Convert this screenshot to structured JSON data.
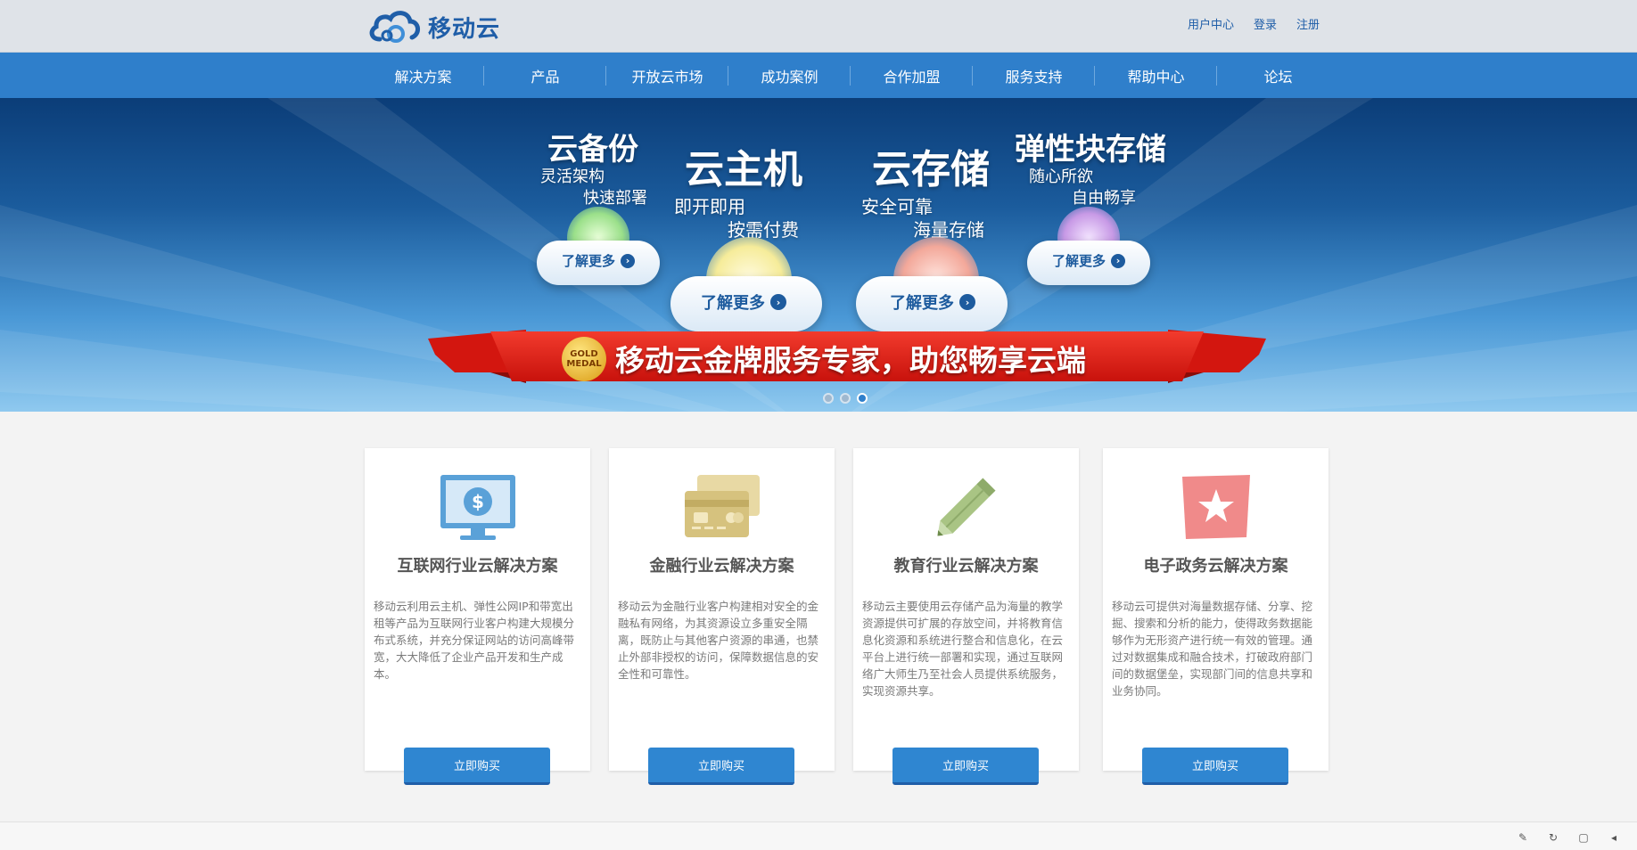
{
  "header": {
    "logo_text": "移动云",
    "links": [
      "用户中心",
      "登录",
      "注册"
    ]
  },
  "nav": {
    "items": [
      "解决方案",
      "产品",
      "开放云市场",
      "成功案例",
      "合作加盟",
      "服务支持",
      "帮助中心",
      "论坛"
    ]
  },
  "banner": {
    "products": [
      {
        "title": "云备份",
        "sub1": "灵活架构",
        "sub2": "快速部署",
        "more": "了解更多"
      },
      {
        "title": "云主机",
        "sub1": "即开即用",
        "sub2": "按需付费",
        "more": "了解更多"
      },
      {
        "title": "云存储",
        "sub1": "安全可靠",
        "sub2": "海量存储",
        "more": "了解更多"
      },
      {
        "title": "弹性块存储",
        "sub1": "随心所欲",
        "sub2": "自由畅享",
        "more": "了解更多"
      }
    ],
    "medal_text": "GOLD MEDAL",
    "slogan": "移动云金牌服务专家，助您畅享云端",
    "slide_count": 3,
    "active_slide": 3
  },
  "solutions": [
    {
      "title": "互联网行业云解决方案",
      "desc": "移动云利用云主机、弹性公网IP和带宽出租等产品为互联网行业客户构建大规模分布式系统，并充分保证网站的访问高峰带宽，大大降低了企业产品开发和生产成本。",
      "button": "立即购买",
      "icon": "monitor-dollar-icon",
      "icon_color": "#5aa1d8"
    },
    {
      "title": "金融行业云解决方案",
      "desc": "移动云为金融行业客户构建相对安全的金融私有网络，为其资源设立多重安全隔离，既防止与其他客户资源的串通，也禁止外部非授权的访问，保障数据信息的安全性和可靠性。",
      "button": "立即购买",
      "icon": "credit-card-icon",
      "icon_color": "#d6c27e"
    },
    {
      "title": "教育行业云解决方案",
      "desc": "移动云主要使用云存储产品为海量的教学资源提供可扩展的存放空间，并将教育信息化资源和系统进行整合和信息化，在云平台上进行统一部署和实现，通过互联网络广大师生乃至社会人员提供系统服务，实现资源共享。",
      "button": "立即购买",
      "icon": "pencil-icon",
      "icon_color": "#a9c484"
    },
    {
      "title": "电子政务云解决方案",
      "desc": "移动云可提供对海量数据存储、分享、挖掘、搜索和分析的能力，使得政务数据能够作为无形资产进行统一有效的管理。通过对数据集成和融合技术，打破政府部门间的数据堡垒，实现部门间的信息共享和业务协同。",
      "button": "立即购买",
      "icon": "star-flag-icon",
      "icon_color": "#f08a8a"
    }
  ]
}
